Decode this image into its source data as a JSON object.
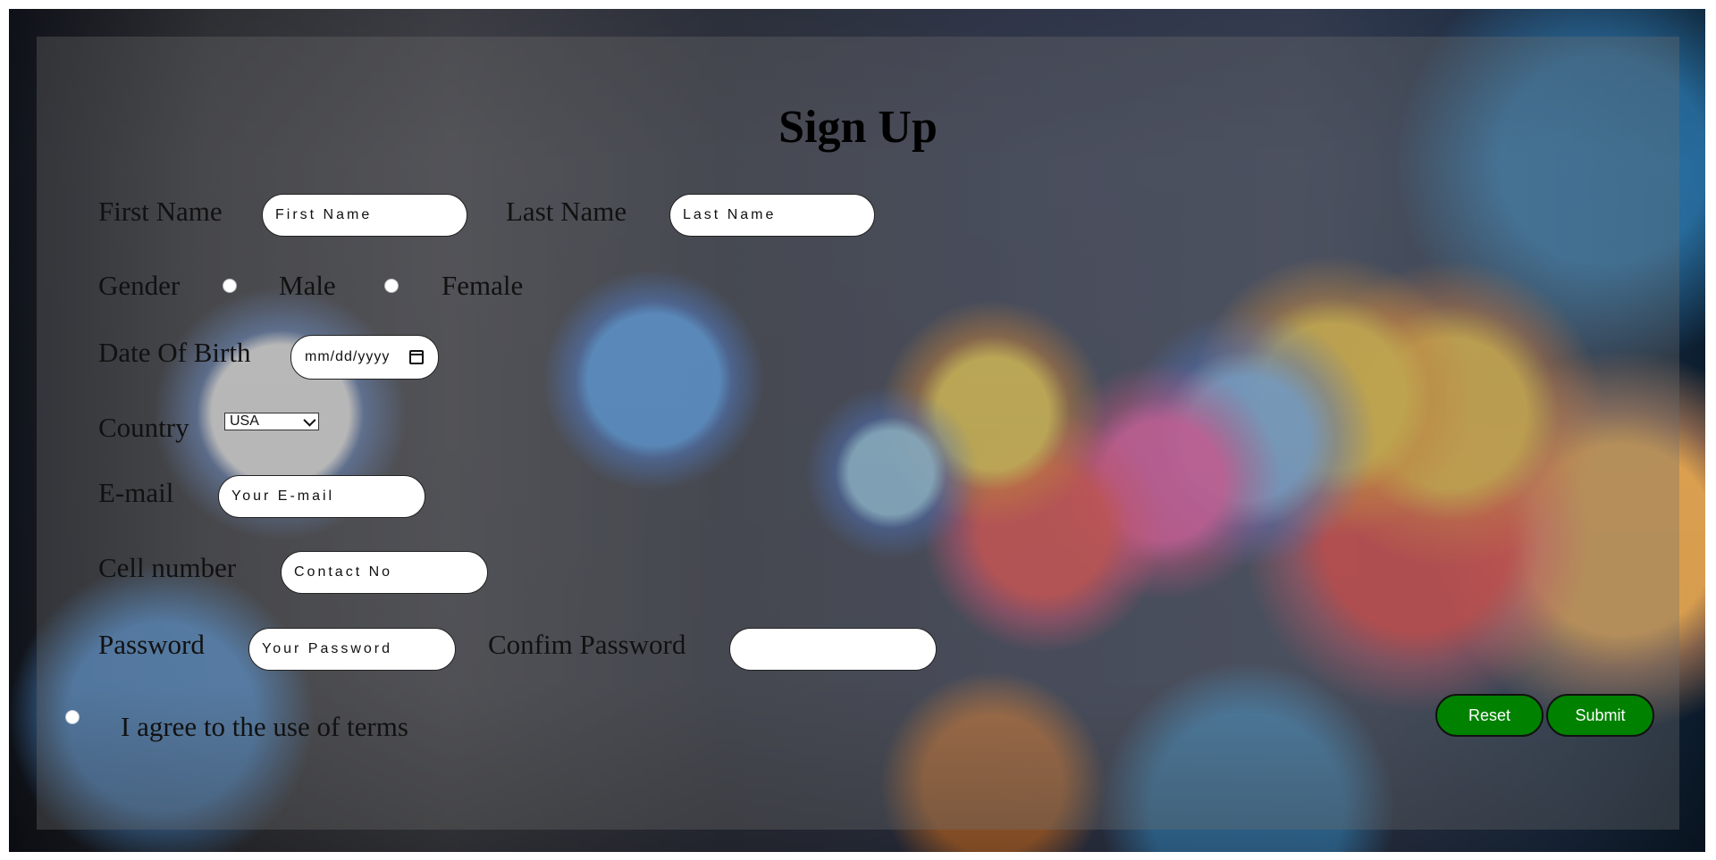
{
  "title": "Sign Up",
  "fields": {
    "first_name_label": "First Name",
    "first_name_placeholder": "First Name",
    "last_name_label": "Last Name",
    "last_name_placeholder": "Last Name",
    "gender_label": "Gender",
    "gender_options": [
      "Male",
      "Female"
    ],
    "dob_label": "Date Of Birth",
    "dob_placeholder": "mm/dd/yyyy",
    "country_label": "Country",
    "country_value": "USA",
    "email_label": "E-mail",
    "email_placeholder": "Your E-mail",
    "cell_label": "Cell number",
    "cell_placeholder": "Contact No",
    "password_label": "Password",
    "password_placeholder": "Your Password",
    "confirm_password_label": "Confim Password",
    "confirm_password_placeholder": "",
    "terms_label": "I agree to the use of terms"
  },
  "buttons": {
    "reset": "Reset",
    "submit": "Submit"
  },
  "colors": {
    "button_green": "#008200",
    "panel_overlay": "#6e6e6e"
  },
  "icons": {
    "calendar": "calendar-icon",
    "dropdown": "chevron-down-icon"
  }
}
